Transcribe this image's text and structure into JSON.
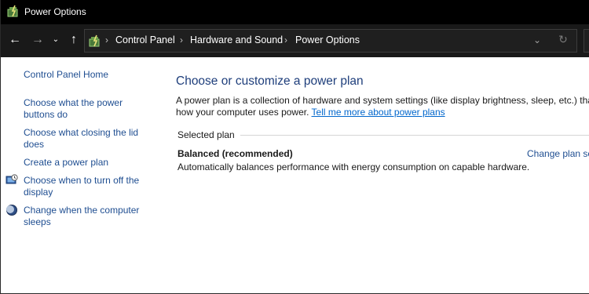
{
  "window": {
    "title": "Power Options",
    "icon": "power-options-icon"
  },
  "nav": {
    "back_icon": "arrow-left-icon",
    "forward_icon": "arrow-right-icon",
    "recent_icon": "chevron-down-icon",
    "up_icon": "arrow-up-icon",
    "back_glyph": "←",
    "forward_glyph": "→",
    "recent_glyph": "⌄",
    "up_glyph": "↑"
  },
  "address": {
    "sep": "›",
    "crumbs": [
      "Control Panel",
      "Hardware and Sound",
      "Power Options"
    ],
    "dropdown_glyph": "⌄",
    "refresh_glyph": "↻"
  },
  "sidebar": {
    "home": "Control Panel Home",
    "items": [
      {
        "label_line1": "Choose what the power",
        "label_line2": "buttons do"
      },
      {
        "label_line1": "Choose what closing the lid",
        "label_line2": "does"
      },
      {
        "label_line1": "Create a power plan",
        "label_line2": ""
      },
      {
        "label_line1": "Choose when to turn off the",
        "label_line2": "display",
        "icon": "display-clock-icon"
      },
      {
        "label_line1": "Change when the computer",
        "label_line2": "sleeps",
        "icon": "moon-sleep-icon"
      }
    ]
  },
  "main": {
    "heading": "Choose or customize a power plan",
    "desc_line1": "A power plan is a collection of hardware and system settings (like display brightness, sleep, etc.) that",
    "desc_line2_prefix": "how your computer uses power.",
    "desc_link": "Tell me more about power plans",
    "section_label": "Selected plan",
    "plan": {
      "name": "Balanced (recommended)",
      "description": "Automatically balances performance with energy consumption on capable hardware.",
      "change_link": "Change plan se"
    }
  },
  "colors": {
    "titlebar_bg": "#000000",
    "navrow_bg": "#191919",
    "link": "#1f4e91",
    "heading": "#1e3e7b",
    "hyperlink": "#0066cc"
  }
}
